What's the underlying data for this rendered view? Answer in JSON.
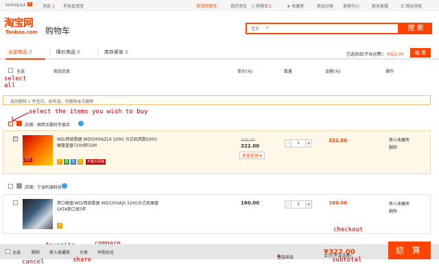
{
  "topbar": {
    "username": "bobalpaul",
    "user_badge": "V",
    "messages_label": "消息",
    "messages_count": "1",
    "mobile_label": "手机逛淘宝",
    "taobao_home": "淘宝网首页",
    "my_taobao": "我的淘宝",
    "cart_label": "购物车",
    "cart_count": "3",
    "favorites": "收藏夹",
    "categories": "商品分类",
    "seller_center": "卖家中心",
    "customer_service": "联系客服",
    "site_nav": "网站导航"
  },
  "header": {
    "logo_text": "淘宝网",
    "logo_sub": "Taobao.com",
    "page_title": "购物车",
    "search_scope": "宝贝",
    "search_placeholder": "",
    "search_button": "搜 索"
  },
  "tabs": [
    {
      "label": "全部商品",
      "count": "2"
    },
    {
      "label": "降价商品",
      "count": "0"
    },
    {
      "label": "库存紧张",
      "count": "0"
    }
  ],
  "summary_top": {
    "label": "已选商品(不含运费)：",
    "amount": "¥322.00",
    "settle_label": "结 算"
  },
  "columns": {
    "select_all": "全选",
    "product_info": "商品信息",
    "unit_price": "单价(元)",
    "quantity": "数量",
    "amount": "金额(元)",
    "actions": "操作"
  },
  "notice": "成功删除 1 件宝贝，如有误，可撤销本次删除",
  "shops": [
    {
      "label": "店铺：",
      "name": "屏西玉数码专营店",
      "items": [
        {
          "title": "WD/西部数据 WD5000AZLX 500G 台式机西数500G硬盘蓝盘7200转32M",
          "thumb_tag": "322",
          "promo_tag": "天猫大促销",
          "price_old": "335.00",
          "price_now": "322.00",
          "promo": "卖家促销 ▾",
          "quantity": "1",
          "amount": "322.00",
          "action_fav": "移入收藏夹",
          "action_delete": "删除"
        }
      ]
    },
    {
      "label": "店铺：",
      "name": "宁波利源科技",
      "items": [
        {
          "title": "串口硬盘/WD/西部数据 WD3200AJS 320G台式机硬盘SATA串口保3年",
          "price_now": "160.00",
          "quantity": "1",
          "amount": "160.00",
          "action_fav": "移入收藏夹",
          "action_delete": "删除"
        }
      ]
    }
  ],
  "bottom": {
    "select_all": "全选",
    "delete": "删除",
    "move_fav": "移入收藏夹",
    "share": "分享",
    "compare": "并购优化",
    "selected_label": "已选商品",
    "selected_count": "1",
    "selected_unit": "件",
    "total_label": "合计(不含运费)：",
    "total_amount": "¥322.00",
    "checkout": "结 算"
  },
  "annotations": {
    "select_all": [
      "select",
      "all"
    ],
    "select_items": "select the items you wish to buy",
    "favorite": "favorite",
    "compare": "compare",
    "share": "share",
    "cancel": "cancel",
    "checkout": "checkout",
    "subtotal": "subtotal"
  },
  "colors": {
    "accent": "#ff4400",
    "annotation": "#cc0000",
    "selected_row_bg": "#fff8e8"
  }
}
